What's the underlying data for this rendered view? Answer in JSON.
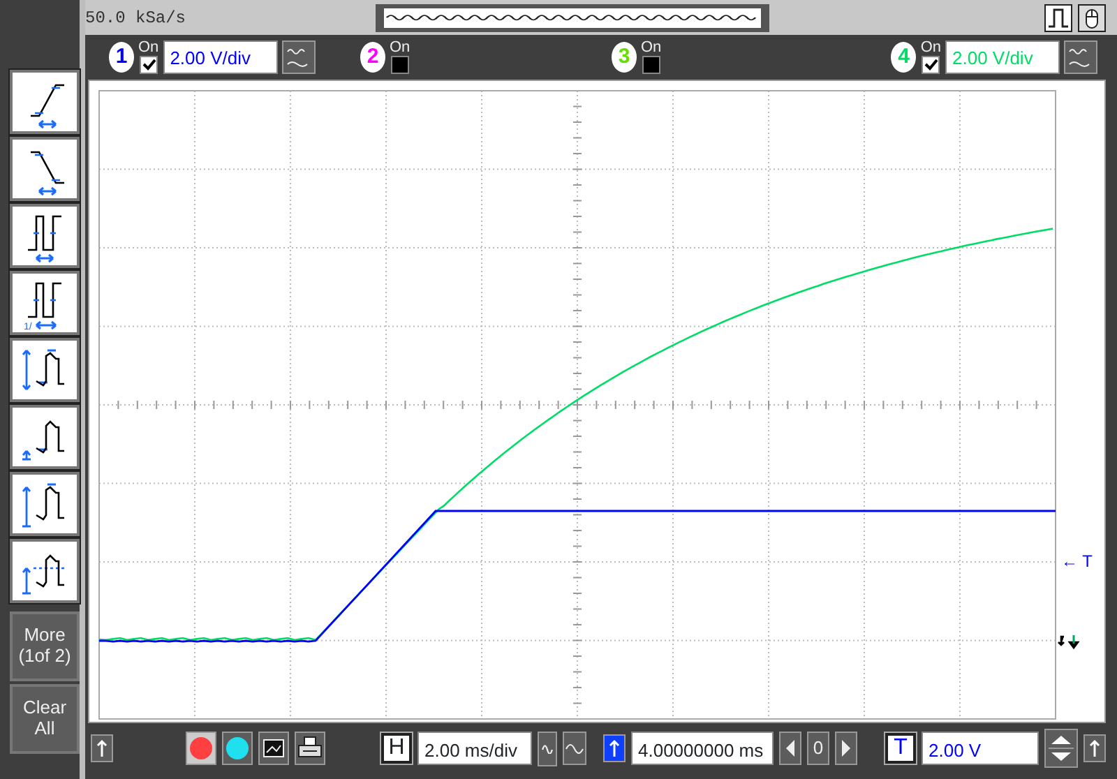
{
  "sample_rate": "50.0 kSa/s",
  "channels": [
    {
      "number": "1",
      "on_label": "On",
      "on": true,
      "scale": "2.00 V/div",
      "color": "#0000ff"
    },
    {
      "number": "2",
      "on_label": "On",
      "on": false,
      "color": "#ff00ff"
    },
    {
      "number": "3",
      "on_label": "On",
      "on": false,
      "color": "#66dd00"
    },
    {
      "number": "4",
      "on_label": "On",
      "on": true,
      "scale": "2.00 V/div",
      "color": "#00dd66"
    }
  ],
  "measurements": [
    {
      "kind": "rise"
    },
    {
      "kind": "fall"
    },
    {
      "kind": "width"
    },
    {
      "kind": "frequency",
      "glyph": "1/"
    },
    {
      "kind": "peak"
    },
    {
      "kind": "base"
    },
    {
      "kind": "top"
    },
    {
      "kind": "average"
    }
  ],
  "sidebar_buttons": [
    {
      "label": "More (1of 2)"
    },
    {
      "label": "Clear All"
    }
  ],
  "trigger_marker": "← T",
  "bottom": {
    "horizontal_label": "H",
    "time_scale": "2.00 ms/div",
    "delay": "4.00000000 ms",
    "step": "0",
    "trigger_label": "T",
    "trigger_level": "2.00 V"
  }
}
